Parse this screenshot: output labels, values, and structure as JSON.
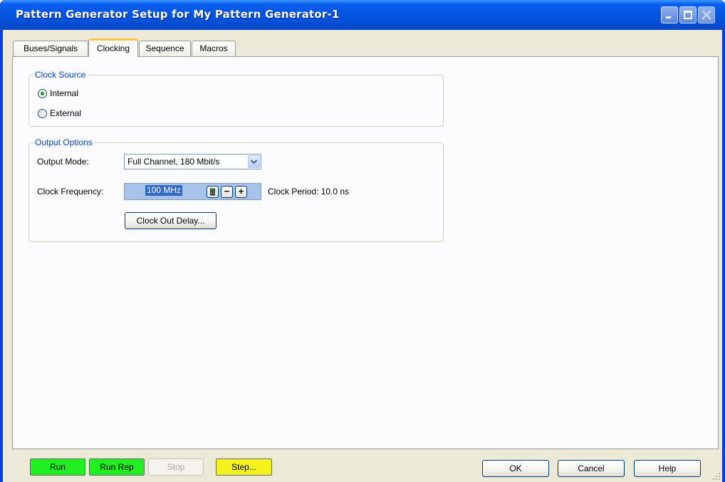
{
  "window": {
    "title": "Pattern Generator Setup for My Pattern Generator-1"
  },
  "tabs": [
    {
      "label": "Buses/Signals",
      "active": false
    },
    {
      "label": "Clocking",
      "active": true
    },
    {
      "label": "Sequence",
      "active": false
    },
    {
      "label": "Macros",
      "active": false
    }
  ],
  "clock_source": {
    "title": "Clock Source",
    "options": [
      {
        "label": "Internal",
        "selected": true
      },
      {
        "label": "External",
        "selected": false
      }
    ]
  },
  "output_options": {
    "title": "Output Options",
    "output_mode_label": "Output Mode:",
    "output_mode_value": "Full Channel, 180 Mbit/s",
    "clock_frequency_label": "Clock Frequency:",
    "clock_frequency_value": "100 MHz",
    "minus_label": "−",
    "plus_label": "+",
    "clock_period_text": "Clock Period: 10.0 ns",
    "clock_out_delay_label": "Clock Out Delay..."
  },
  "bottom_bar": {
    "run_label": "Run",
    "run_rep_label": "Run Rep",
    "stop_label": "Stop",
    "step_label": "Step...",
    "ok_label": "OK",
    "cancel_label": "Cancel",
    "help_label": "Help"
  },
  "colors": {
    "titlebar": "#0455e2",
    "run_green": "#20f020",
    "step_yellow": "#f4f41c",
    "group_title_blue": "#0046d5",
    "selection_blue": "#316ac5"
  }
}
